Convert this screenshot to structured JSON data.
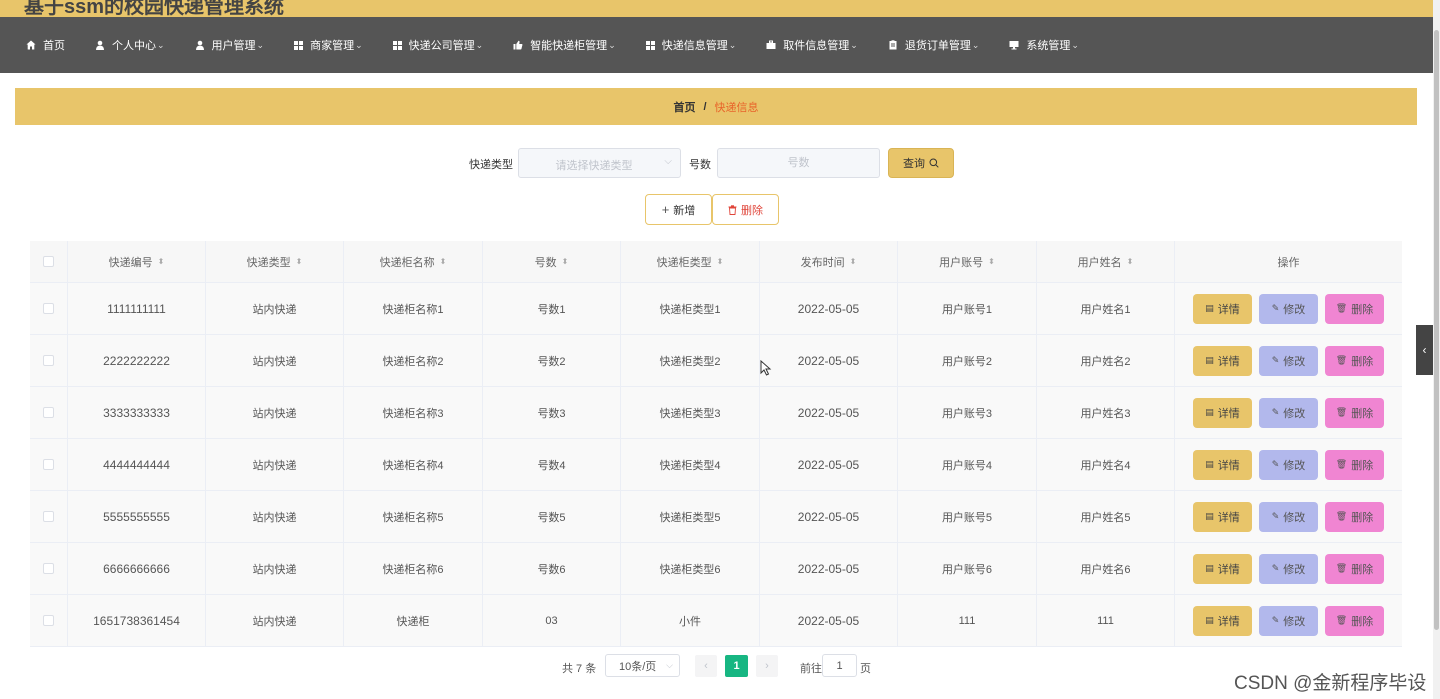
{
  "header": {
    "title": "基于ssm的校园快递管理系统"
  },
  "nav": {
    "items": [
      {
        "label": "首页",
        "icon": "home-icon",
        "chevron": ""
      },
      {
        "label": "个人中心",
        "icon": "user-icon",
        "chevron": "⌄"
      },
      {
        "label": "用户管理",
        "icon": "user-icon",
        "chevron": "⌄"
      },
      {
        "label": "商家管理",
        "icon": "grid-icon",
        "chevron": "⌄"
      },
      {
        "label": "快递公司管理",
        "icon": "grid-icon",
        "chevron": "⌄"
      },
      {
        "label": "智能快递柜管理",
        "icon": "thumb-icon",
        "chevron": "⌄"
      },
      {
        "label": "快递信息管理",
        "icon": "grid-icon",
        "chevron": "⌄"
      },
      {
        "label": "取件信息管理",
        "icon": "briefcase-icon",
        "chevron": "⌄"
      },
      {
        "label": "退货订单管理",
        "icon": "clipboard-icon",
        "chevron": "⌄"
      },
      {
        "label": "系统管理",
        "icon": "monitor-icon",
        "chevron": "⌄"
      }
    ]
  },
  "breadcrumb": {
    "home": "首页",
    "separator": "/",
    "current": "快递信息"
  },
  "search": {
    "type_label": "快递类型",
    "type_placeholder": "请选择快递类型",
    "number_label": "号数",
    "number_placeholder": "号数",
    "query_label": "查询"
  },
  "actions": {
    "add_label": "新增",
    "delete_label": "删除"
  },
  "table": {
    "headers": [
      "快递编号",
      "快递类型",
      "快递柜名称",
      "号数",
      "快递柜类型",
      "发布时间",
      "用户账号",
      "用户姓名"
    ],
    "ops_header": "操作",
    "op_labels": {
      "detail": "详情",
      "edit": "修改",
      "delete": "删除"
    },
    "rows": [
      [
        "1111111111",
        "站内快递",
        "快递柜名称1",
        "号数1",
        "快递柜类型1",
        "2022-05-05",
        "用户账号1",
        "用户姓名1"
      ],
      [
        "2222222222",
        "站内快递",
        "快递柜名称2",
        "号数2",
        "快递柜类型2",
        "2022-05-05",
        "用户账号2",
        "用户姓名2"
      ],
      [
        "3333333333",
        "站内快递",
        "快递柜名称3",
        "号数3",
        "快递柜类型3",
        "2022-05-05",
        "用户账号3",
        "用户姓名3"
      ],
      [
        "4444444444",
        "站内快递",
        "快递柜名称4",
        "号数4",
        "快递柜类型4",
        "2022-05-05",
        "用户账号4",
        "用户姓名4"
      ],
      [
        "5555555555",
        "站内快递",
        "快递柜名称5",
        "号数5",
        "快递柜类型5",
        "2022-05-05",
        "用户账号5",
        "用户姓名5"
      ],
      [
        "6666666666",
        "站内快递",
        "快递柜名称6",
        "号数6",
        "快递柜类型6",
        "2022-05-05",
        "用户账号6",
        "用户姓名6"
      ],
      [
        "1651738361454",
        "站内快递",
        "快递柜",
        "03",
        "小件",
        "2022-05-05",
        "111",
        "111"
      ]
    ]
  },
  "pagination": {
    "total": "共 7 条",
    "page_size": "10条/页",
    "prev": "‹",
    "current_page": "1",
    "next": "›",
    "goto_label": "前往",
    "goto_value": "1",
    "page_suffix": "页"
  },
  "watermark": "CSDN @金新程序毕设",
  "colors": {
    "accent": "#e8c56a",
    "nav_bg": "#555555",
    "active_page": "#17b682",
    "edit_button": "#b2b8ec",
    "delete_button": "#f085d2",
    "breadcrumb_current": "#e8642a"
  }
}
